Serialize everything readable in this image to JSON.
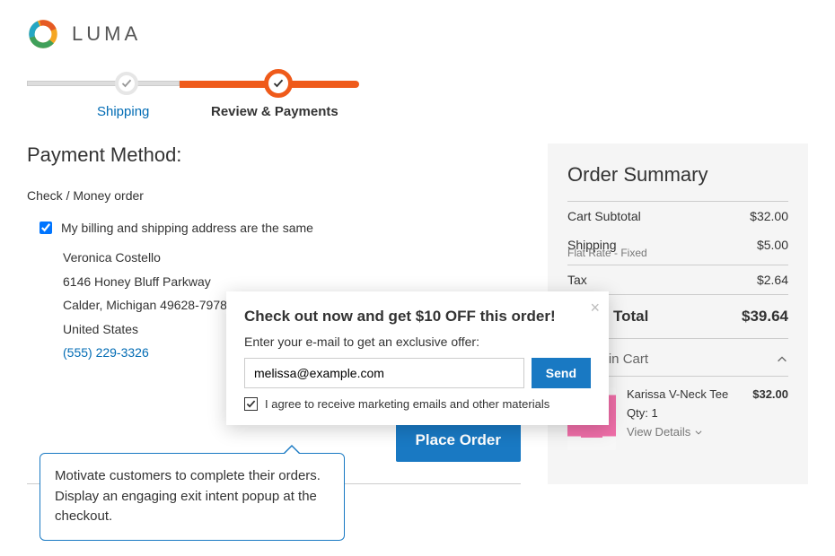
{
  "logo_text": "LUMA",
  "steps": {
    "shipping": "Shipping",
    "review": "Review & Payments"
  },
  "payment": {
    "title": "Payment Method:",
    "method": "Check / Money order",
    "billing_same_label": "My billing and shipping address are the same",
    "address": {
      "name": "Veronica Costello",
      "street": "6146 Honey Bluff Parkway",
      "city_state_zip": "Calder, Michigan 49628-7978",
      "country": "United States",
      "phone": "(555) 229-3326"
    },
    "place_order": "Place Order"
  },
  "summary": {
    "title": "Order Summary",
    "subtotal_label": "Cart Subtotal",
    "subtotal": "$32.00",
    "shipping_label": "Shipping",
    "shipping_method": "Flat Rate - Fixed",
    "shipping": "$5.00",
    "tax_label": "Tax",
    "tax": "$2.64",
    "total_label": "Order Total",
    "total": "$39.64",
    "cart_header": "1 Item in Cart",
    "item": {
      "name": "Karissa V-Neck Tee",
      "price": "$32.00",
      "qty_label": "Qty: 1",
      "view_details": "View Details"
    }
  },
  "popup": {
    "title": "Check out now and get $10 OFF this order!",
    "subtitle": "Enter your e-mail to get an exclusive offer:",
    "email_value": "melissa@example.com",
    "send": "Send",
    "consent": "I agree to receive marketing emails and other materials"
  },
  "callout": "Motivate customers to complete their orders. Display an engaging exit intent popup at the checkout."
}
